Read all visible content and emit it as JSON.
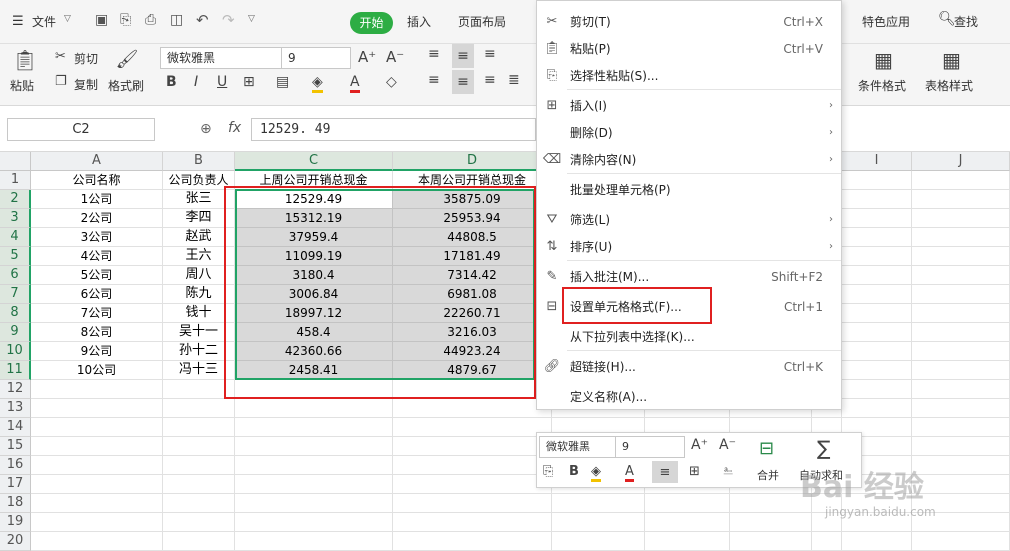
{
  "menubar": {
    "file": "文件",
    "tabs": [
      "开始",
      "插入",
      "页面布局",
      "特色应用",
      "查找"
    ]
  },
  "ribbon": {
    "paste": "粘贴",
    "cut": "剪切",
    "copy": "复制",
    "format_painter": "格式刷",
    "font_name": "微软雅黑",
    "font_size": "9",
    "bold": "B",
    "italic": "I",
    "underline": "U",
    "cond_format": "条件格式",
    "table_style": "表格样式"
  },
  "formula_bar": {
    "name_box": "C2",
    "fx": "fx",
    "value": "12529. 49"
  },
  "columns": [
    "A",
    "B",
    "C",
    "D",
    "",
    "",
    "",
    "",
    "I",
    "J"
  ],
  "rows": [
    "1",
    "2",
    "3",
    "4",
    "5",
    "6",
    "7",
    "8",
    "9",
    "10",
    "11",
    "12",
    "13",
    "14",
    "15",
    "16",
    "17",
    "18",
    "19",
    "20"
  ],
  "table": {
    "headers": [
      "公司名称",
      "公司负责人",
      "上周公司开销总现金",
      "本周公司开销总现金"
    ],
    "data": [
      [
        "1公司",
        "张三",
        "12529.49",
        "35875.09"
      ],
      [
        "2公司",
        "李四",
        "15312.19",
        "25953.94"
      ],
      [
        "3公司",
        "赵武",
        "37959.4",
        "44808.5"
      ],
      [
        "4公司",
        "王六",
        "11099.19",
        "17181.49"
      ],
      [
        "5公司",
        "周八",
        "3180.4",
        "7314.42"
      ],
      [
        "6公司",
        "陈九",
        "3006.84",
        "6981.08"
      ],
      [
        "7公司",
        "钱十",
        "18997.12",
        "22260.71"
      ],
      [
        "8公司",
        "吴十一",
        "458.4",
        "3216.03"
      ],
      [
        "9公司",
        "孙十二",
        "42360.66",
        "44923.24"
      ],
      [
        "10公司",
        "冯十三",
        "2458.41",
        "4879.67"
      ]
    ]
  },
  "context_menu": [
    {
      "label": "剪切(T)",
      "shortcut": "Ctrl+X",
      "icon": "scissors-icon"
    },
    {
      "label": "粘贴(P)",
      "shortcut": "Ctrl+V",
      "icon": "paste-icon"
    },
    {
      "label": "选择性粘贴(S)...",
      "shortcut": "",
      "icon": "paste-special-icon"
    },
    {
      "label": "插入(I)",
      "shortcut": "",
      "icon": "insert-icon"
    },
    {
      "label": "删除(D)",
      "shortcut": "",
      "icon": ""
    },
    {
      "label": "清除内容(N)",
      "shortcut": "",
      "icon": "eraser-icon"
    },
    {
      "label": "批量处理单元格(P)",
      "shortcut": "",
      "icon": ""
    },
    {
      "label": "筛选(L)",
      "shortcut": "",
      "icon": "filter-icon"
    },
    {
      "label": "排序(U)",
      "shortcut": "",
      "icon": "sort-icon"
    },
    {
      "label": "插入批注(M)...",
      "shortcut": "Shift+F2",
      "icon": "comment-icon"
    },
    {
      "label": "设置单元格格式(F)...",
      "shortcut": "Ctrl+1",
      "icon": "format-cells-icon"
    },
    {
      "label": "从下拉列表中选择(K)...",
      "shortcut": "",
      "icon": ""
    },
    {
      "label": "超链接(H)...",
      "shortcut": "Ctrl+K",
      "icon": "link-icon"
    },
    {
      "label": "定义名称(A)...",
      "shortcut": "",
      "icon": ""
    }
  ],
  "mini_toolbar": {
    "font_name": "微软雅黑",
    "font_size": "9",
    "merge": "合并",
    "autosum": "自动求和"
  },
  "watermark": {
    "text": "Bai 经验",
    "url": "jingyan.baidu.com"
  },
  "colors": {
    "accent_green": "#2dad44",
    "selection_border": "#21a366",
    "highlight_red": "#e02020"
  }
}
